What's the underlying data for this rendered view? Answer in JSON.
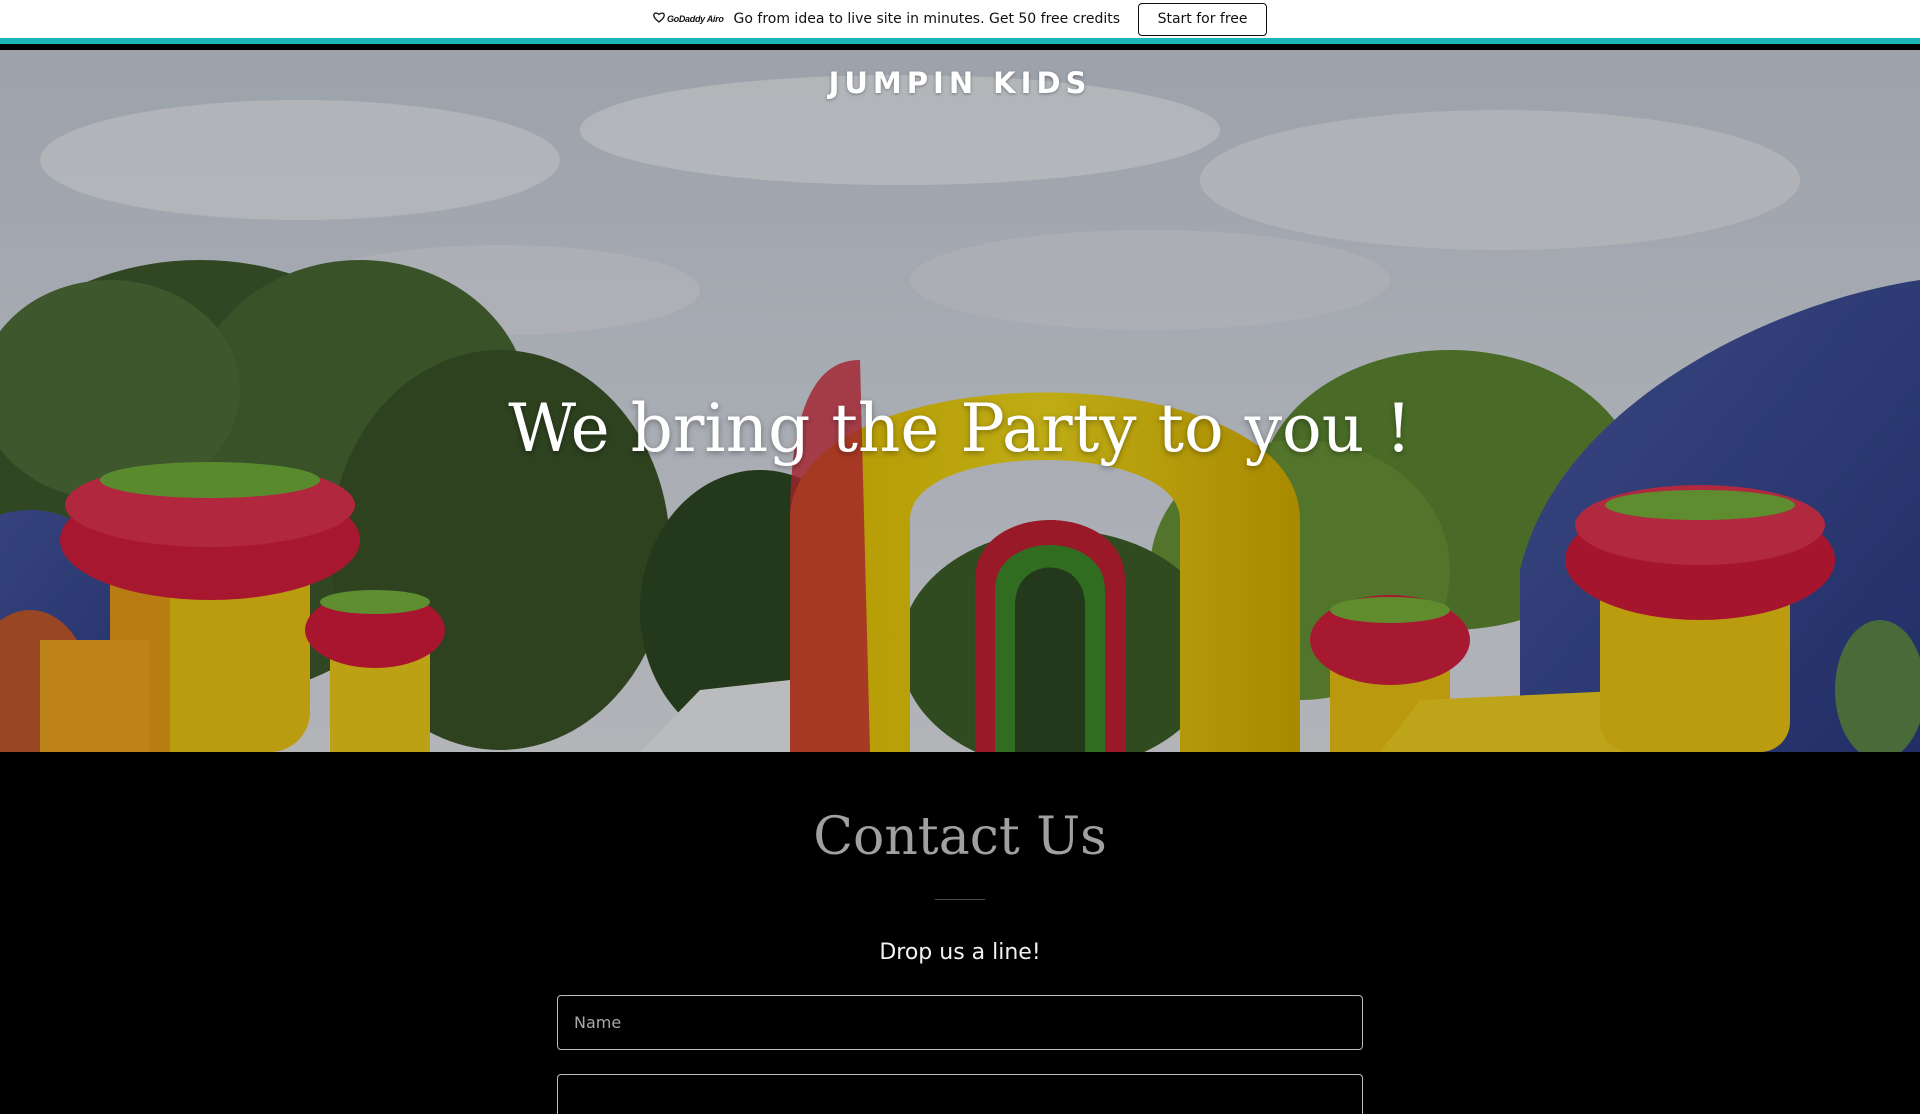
{
  "promo": {
    "logo_text": "GoDaddy Airo",
    "message": "Go from idea to live site in minutes. Get 50 free credits",
    "button_label": "Start for free",
    "accent_color": "#1bb6b6"
  },
  "hero": {
    "site_title": "JUMPIN KIDS",
    "tagline": "We bring the Party to you !"
  },
  "contact": {
    "heading": "Contact Us",
    "subheading": "Drop us a line!",
    "name_placeholder": "Name"
  }
}
